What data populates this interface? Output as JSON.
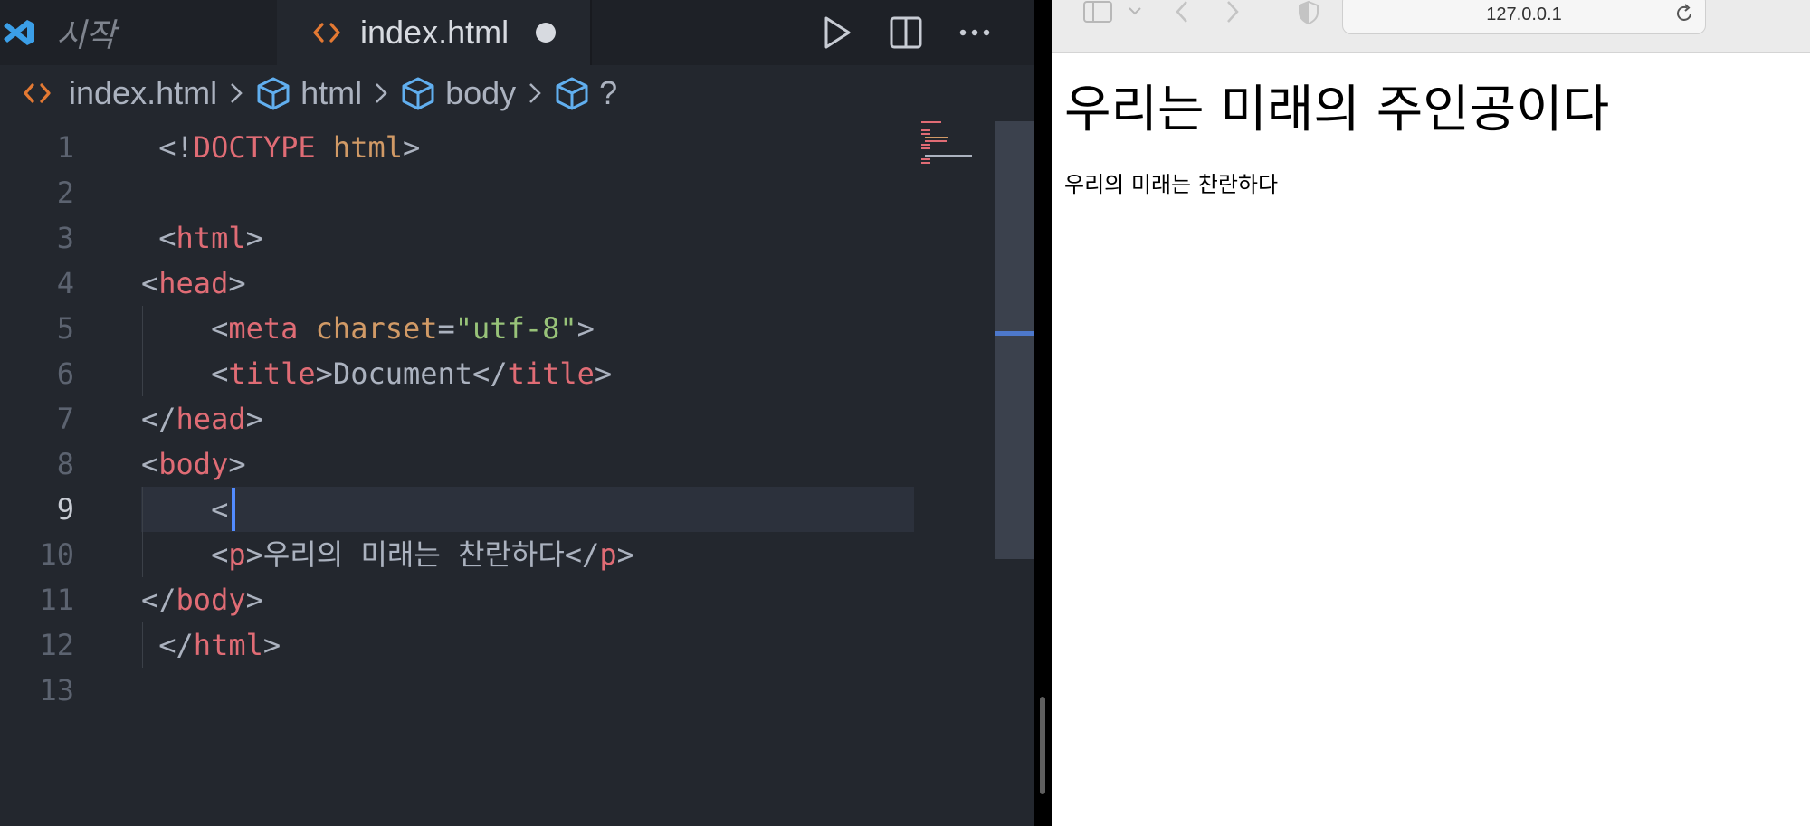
{
  "editor": {
    "tabs": [
      {
        "label": "시작"
      },
      {
        "label": "index.html"
      }
    ],
    "breadcrumb": [
      "index.html",
      "html",
      "body",
      "?"
    ],
    "lines": [
      {
        "num": "1",
        "tokens": [
          {
            "t": " <!",
            "c": ""
          },
          {
            "t": "DOCTYPE",
            "c": "t-doc"
          },
          {
            "t": " ",
            "c": ""
          },
          {
            "t": "html",
            "c": "t-html"
          },
          {
            "t": ">",
            "c": ""
          }
        ]
      },
      {
        "num": "2",
        "tokens": []
      },
      {
        "num": "3",
        "tokens": [
          {
            "t": " <",
            "c": ""
          },
          {
            "t": "html",
            "c": "t-tag"
          },
          {
            "t": ">",
            "c": ""
          }
        ]
      },
      {
        "num": "4",
        "tokens": [
          {
            "t": "<",
            "c": ""
          },
          {
            "t": "head",
            "c": "t-tag"
          },
          {
            "t": ">",
            "c": ""
          }
        ]
      },
      {
        "num": "5",
        "tokens": [
          {
            "t": "    <",
            "c": ""
          },
          {
            "t": "meta",
            "c": "t-tag"
          },
          {
            "t": " ",
            "c": ""
          },
          {
            "t": "charset",
            "c": "t-attr"
          },
          {
            "t": "=",
            "c": ""
          },
          {
            "t": "\"utf-8\"",
            "c": "t-str"
          },
          {
            "t": ">",
            "c": ""
          }
        ]
      },
      {
        "num": "6",
        "tokens": [
          {
            "t": "    <",
            "c": ""
          },
          {
            "t": "title",
            "c": "t-tag"
          },
          {
            "t": ">Document</",
            "c": ""
          },
          {
            "t": "title",
            "c": "t-tag"
          },
          {
            "t": ">",
            "c": ""
          }
        ]
      },
      {
        "num": "7",
        "tokens": [
          {
            "t": "</",
            "c": ""
          },
          {
            "t": "head",
            "c": "t-tag"
          },
          {
            "t": ">",
            "c": ""
          }
        ]
      },
      {
        "num": "8",
        "tokens": [
          {
            "t": "<",
            "c": ""
          },
          {
            "t": "body",
            "c": "t-tag"
          },
          {
            "t": ">",
            "c": ""
          }
        ]
      },
      {
        "num": "9",
        "tokens": [
          {
            "t": "    <",
            "c": ""
          }
        ]
      },
      {
        "num": "10",
        "tokens": [
          {
            "t": "    <",
            "c": ""
          },
          {
            "t": "p",
            "c": "t-tag"
          },
          {
            "t": ">우리의 미래는 찬란하다</",
            "c": ""
          },
          {
            "t": "p",
            "c": "t-tag"
          },
          {
            "t": ">",
            "c": ""
          }
        ]
      },
      {
        "num": "11",
        "tokens": [
          {
            "t": "</",
            "c": ""
          },
          {
            "t": "body",
            "c": "t-tag"
          },
          {
            "t": ">",
            "c": ""
          }
        ]
      },
      {
        "num": "12",
        "tokens": [
          {
            "t": " </",
            "c": ""
          },
          {
            "t": "html",
            "c": "t-tag"
          },
          {
            "t": ">",
            "c": ""
          }
        ]
      },
      {
        "num": "13",
        "tokens": []
      }
    ],
    "active_line": "9"
  },
  "browser": {
    "url": "127.0.0.1",
    "heading": "우리는 미래의 주인공이다",
    "paragraph": "우리의 미래는 찬란하다"
  },
  "colors": {
    "editor_bg": "#23272e",
    "tag": "#e06c75",
    "attr": "#d19a66",
    "string": "#98c379",
    "accent": "#528bff"
  }
}
